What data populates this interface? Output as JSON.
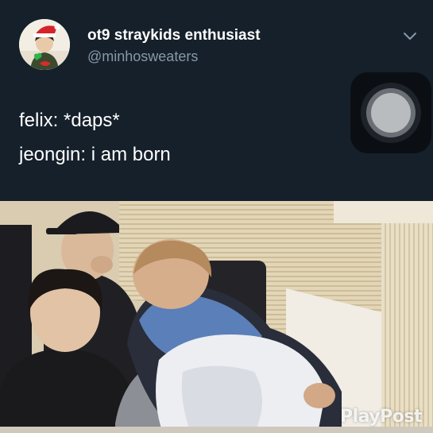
{
  "tweet": {
    "display_name": "ot9 straykids enthusiast",
    "handle": "@minhosweaters",
    "lines": [
      "felix: *daps*",
      "jeongin: i am born"
    ],
    "avatar_icon": "profile-avatar",
    "menu_icon": "chevron-down-icon"
  },
  "overlay": {
    "assistive_icon": "assistive-touch-icon"
  },
  "photo": {
    "watermark": "PlayPost"
  },
  "colors": {
    "tweet_background": "#15202b",
    "name_text": "#ffffff",
    "handle_text": "#8899a6"
  }
}
